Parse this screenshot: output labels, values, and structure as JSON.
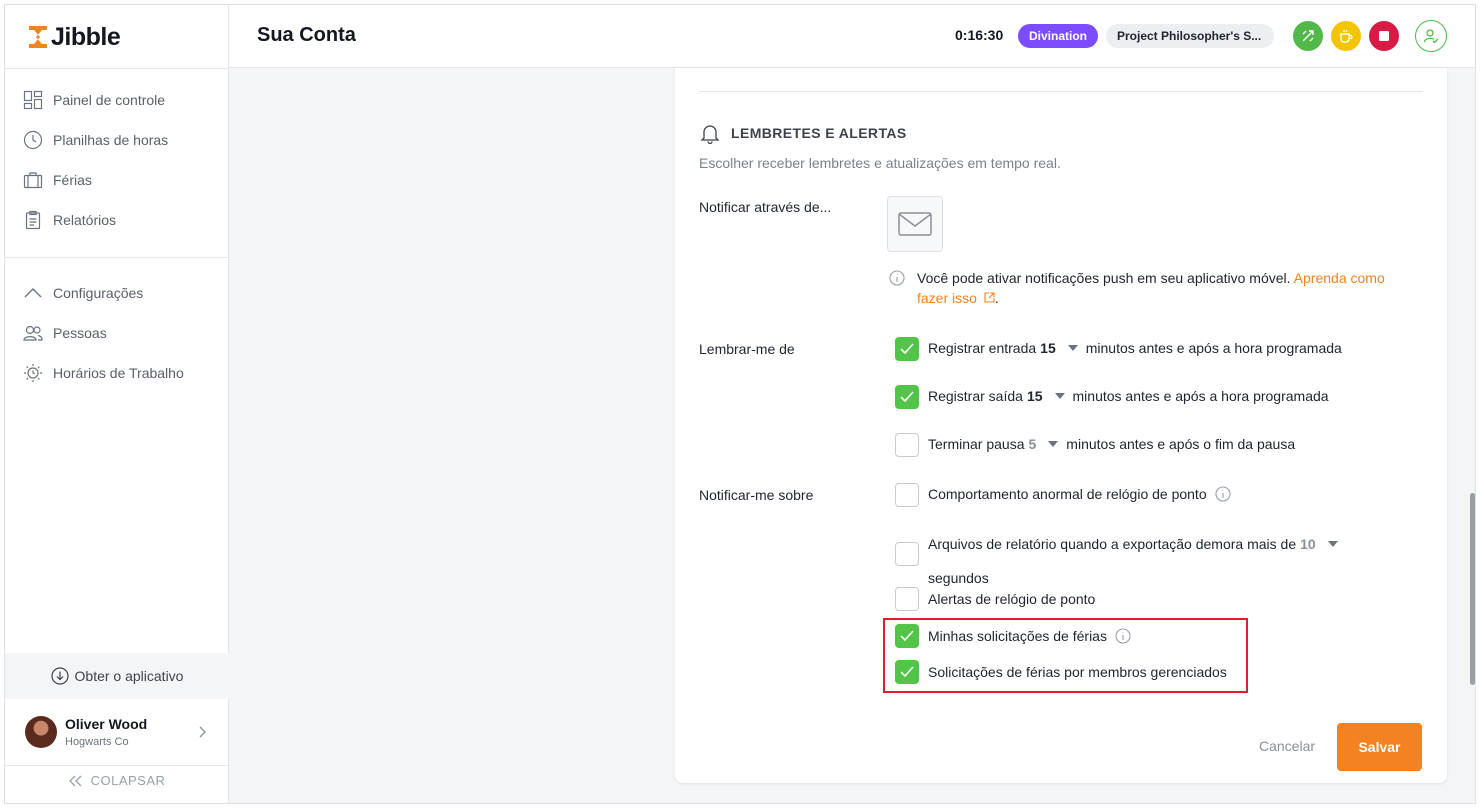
{
  "app": {
    "name": "Jibble",
    "brand_color": "#f58220"
  },
  "sidebar": {
    "nav": [
      {
        "label": "Painel de controle",
        "icon": "dashboard-icon"
      },
      {
        "label": "Planilhas de horas",
        "icon": "clock-icon"
      },
      {
        "label": "Férias",
        "icon": "suitcase-icon"
      },
      {
        "label": "Relatórios",
        "icon": "clipboard-icon"
      }
    ],
    "settings": [
      {
        "label": "Configurações",
        "icon": "chevron-up-icon"
      },
      {
        "label": "Pessoas",
        "icon": "people-icon"
      },
      {
        "label": "Horários de Trabalho",
        "icon": "sun-clock-icon"
      }
    ],
    "get_app": "Obter o aplicativo",
    "user": {
      "name": "Oliver Wood",
      "org": "Hogwarts Co"
    },
    "collapse": "COLAPSAR"
  },
  "header": {
    "title": "Sua Conta",
    "timer": "0:16:30",
    "activity": "Divination",
    "activity_color": "#7b4dff",
    "project": "Project Philosopher's S...",
    "actions": [
      {
        "icon": "switch-activity-icon",
        "color": "#52b84a"
      },
      {
        "icon": "break-icon",
        "color": "#f5c400"
      },
      {
        "icon": "stop-icon",
        "color": "#d91a45"
      },
      {
        "icon": "user-check-icon",
        "color": "#52b84a"
      }
    ]
  },
  "reminders": {
    "title": "LEMBRETES E ALERTAS",
    "description": "Escolher receber lembretes e atualizações em tempo real.",
    "notify_via_label": "Notificar através de...",
    "channel_icon": "email-icon",
    "push_note": "Você pode ativar notificações push em seu aplicativo móvel.",
    "push_link_a": "Aprenda como",
    "push_link_b": "fazer isso",
    "push_end": ".",
    "remind_label": "Lembrar-me de",
    "remind_items": [
      {
        "text_before": "Registrar entrada",
        "value": "15",
        "text_after": "minutos antes e após a hora programada",
        "checked": true
      },
      {
        "text_before": "Registrar saída",
        "value": "15",
        "text_after": "minutos antes e após a hora programada",
        "checked": true
      },
      {
        "text_before": "Terminar pausa",
        "value": "5",
        "text_after": "minutos antes e após o fim da pausa",
        "checked": false
      }
    ],
    "notify_label": "Notificar-me sobre",
    "notify_items": [
      {
        "text": "Comportamento anormal de relógio de ponto",
        "checked": false,
        "info": true
      },
      {
        "text": "Arquivos de relatório quando a exportação demora mais de",
        "value": "10",
        "text_after": "segundos",
        "checked": false
      },
      {
        "text": "Alertas de relógio de ponto",
        "checked": false
      },
      {
        "text": "Minhas solicitações de férias",
        "checked": true,
        "info": true
      },
      {
        "text": "Solicitações de férias por membros gerenciados",
        "checked": true
      }
    ],
    "highlight_color": "#e21d2d",
    "check_color": "#52c447"
  },
  "footer": {
    "cancel": "Cancelar",
    "save": "Salvar"
  }
}
